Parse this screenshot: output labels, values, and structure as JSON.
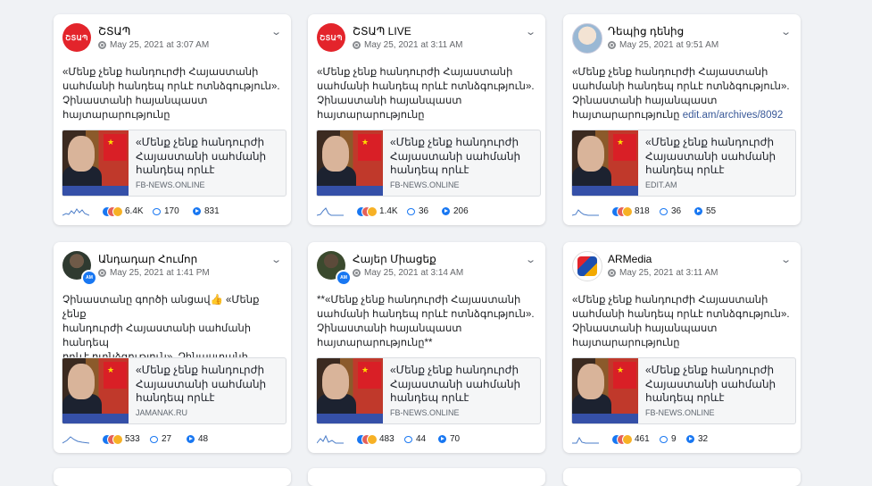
{
  "posts": [
    {
      "author": "ՇՏԱՊ",
      "avatar_text": "ՇՏԱՊ",
      "time": "May 25, 2021 at 3:07 AM",
      "text": "«Մենք չենք հանդուրժի Հայաստանի\nսահմանի հանդեպ որևէ ոտնձգություն».\nՉինաստանի հայանպաստ\nհայտարարությունը",
      "link_suffix": "",
      "link_title": "«Մենք չենք հանդուրժի\nՀայաստանի սահմանի\nհանդեպ որևէ",
      "link_domain": "FB-NEWS.ONLINE",
      "reactions": "6.4K",
      "comments": "170",
      "shares": "831"
    },
    {
      "author": "ՇՏԱՊ LIVE",
      "avatar_text": "ՇՏԱՊ",
      "time": "May 25, 2021 at 3:11 AM",
      "text": "«Մենք չենք հանդուրժի Հայաստանի\nսահմանի հանդեպ որևէ ոտնձգություն».\nՉինաստանի հայանպաստ\nհայտարարությունը",
      "link_suffix": "",
      "link_title": "«Մենք չենք հանդուրժի\nՀայաստանի սահմանի\nհանդեպ որևէ",
      "link_domain": "FB-NEWS.ONLINE",
      "reactions": "1.4K",
      "comments": "36",
      "shares": "206"
    },
    {
      "author": "Դեպից դենից",
      "avatar_text": "",
      "time": "May 25, 2021 at 9:51 AM",
      "text": "«Մենք չենք հանդուրժի Հայաստանի\nսահմանի հանդեպ որևէ ոտնձգություն».\nՉինաստանի հայանպաստ\nհայտարարությունը ",
      "link_suffix": "edit.am/archives/8092",
      "link_title": "«Մենք չենք հանդուրժի\nՀայաստանի սահմանի\nհանդեպ որևէ",
      "link_domain": "EDIT.AM",
      "reactions": "818",
      "comments": "36",
      "shares": "55"
    },
    {
      "author": "Անդադար Հումոր",
      "avatar_text": "",
      "time": "May 25, 2021 at 1:41 PM",
      "text": "Չինաստանը գործի անցավ👍 «Մենք չենք\nհանդուրժի Հայաստանի սահմանի հանդեպ\nորևէ ոտնձգություն». Չինաստանի\nհայանպաստ հայտարարությունըAM",
      "link_suffix": "",
      "link_title": "«Մենք չենք հանդուրժի\nՀայաստանի սահմանի\nհանդեպ որևէ",
      "link_domain": "JAMANAK.RU",
      "reactions": "533",
      "comments": "27",
      "shares": "48"
    },
    {
      "author": "Հայեր Միացեք",
      "avatar_text": "",
      "time": "May 25, 2021 at 3:14 AM",
      "text": "**«Մենք չենք հանդուրժի Հայաստանի\nսահմանի հանդեպ որևէ ոտնձգություն».\nՉինաստանի հայանպաստ\nհայտարարությունը**",
      "link_suffix": "",
      "link_title": "«Մենք չենք հանդուրժի\nՀայաստանի սահմանի\nհանդեպ որևէ",
      "link_domain": "FB-NEWS.ONLINE",
      "reactions": "483",
      "comments": "44",
      "shares": "70"
    },
    {
      "author": "ARMedia",
      "avatar_text": "",
      "time": "May 25, 2021 at 3:11 AM",
      "text": "«Մենք չենք հանդուրժի Հայաստանի\nսահմանի հանդեպ որևէ ոտնձգություն».\nՉինաստանի հայանպաստ\nհայտարարությունը",
      "link_suffix": "",
      "link_title": "«Մենք չենք հանդուրժի\nՀայաստանի սահմանի\nհանդեպ որևէ",
      "link_domain": "FB-NEWS.ONLINE",
      "reactions": "461",
      "comments": "9",
      "shares": "32"
    }
  ],
  "icons": {
    "globe": "globe-icon",
    "menu": "chevron-down-icon",
    "comment": "comment-icon",
    "share": "share-icon"
  },
  "colors": {
    "background": "#f0f2f5",
    "accent": "#1877f2",
    "brand_red": "#e3242b",
    "link": "#385898"
  }
}
